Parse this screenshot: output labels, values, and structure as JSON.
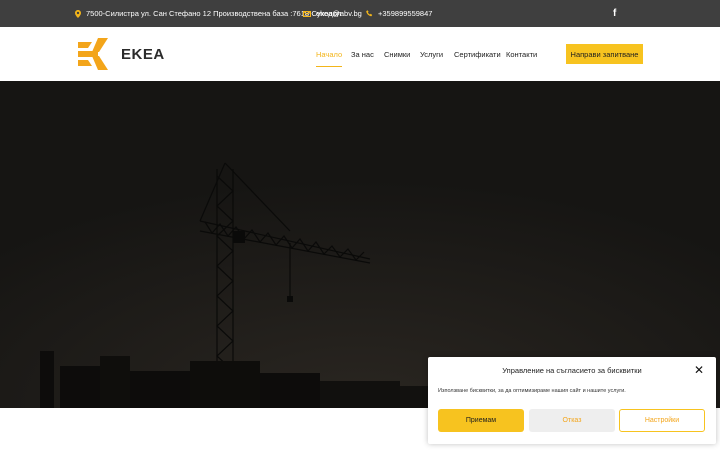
{
  "topbar": {
    "address": "7500-Силистра ул. Сан Стефано 12 Производствена база :7618-Суходол",
    "email": "ekea@abv.bg",
    "phone": "+359899559847",
    "address_icon": "map-pin-icon",
    "email_icon": "envelope-icon",
    "phone_icon": "phone-icon",
    "social_icon": "facebook-icon",
    "social_label": "f"
  },
  "header": {
    "logo_text": "EKEA",
    "nav": [
      {
        "label": "Начало",
        "active": true
      },
      {
        "label": "За нас",
        "active": false
      },
      {
        "label": "Снимки",
        "active": false
      },
      {
        "label": "Услуги",
        "active": false
      },
      {
        "label": "Сертификати",
        "active": false
      },
      {
        "label": "Контакти",
        "active": false
      }
    ],
    "cta_label": "Направи запитване"
  },
  "colors": {
    "accent": "#f7c31f",
    "topbar_bg": "#3f3f3f",
    "hero_bg": "#1b1a18"
  },
  "cookie": {
    "title": "Управление на съгласието за бисквитки",
    "text": "Използване бисквитки, за да оптимизираме нашия сайт и нашите услуги.",
    "accept_label": "Приемам",
    "deny_label": "Отказ",
    "settings_label": "Настройки",
    "close_icon": "close-icon"
  }
}
